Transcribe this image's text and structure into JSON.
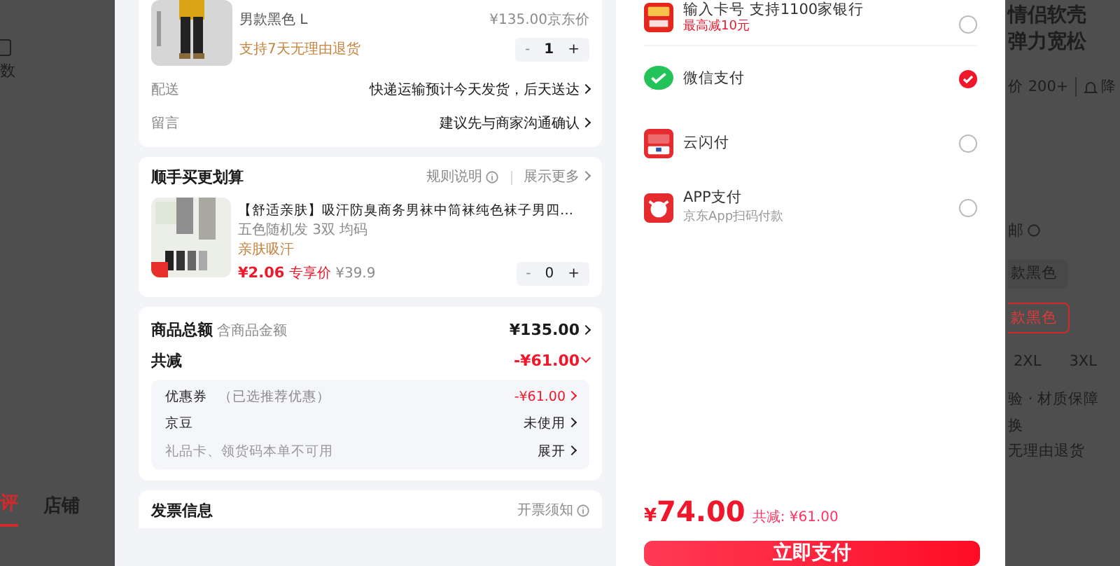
{
  "background_page": {
    "left_texts": [
      "数"
    ],
    "tabs": [
      {
        "label": "评",
        "selected": true
      },
      {
        "label": "店铺",
        "selected": false
      }
    ],
    "right_title": [
      "情侣软壳",
      "弹力宽松"
    ],
    "right_stats": [
      "价 200+",
      "降"
    ],
    "right_section": "邮",
    "colors": [
      {
        "label": "款黑色",
        "selected": false
      },
      {
        "label": "款黑色",
        "selected": true
      }
    ],
    "sizes": [
      "2XL",
      "3XL"
    ],
    "service_title": "验 · 材质保障",
    "services": [
      "换",
      "无理由退货"
    ]
  },
  "product": {
    "variant": "男款黑色  L",
    "service": "支持7天无理由退货",
    "price": "¥135.00",
    "price_label": "京东价",
    "quantity": "1",
    "minus": "-",
    "plus": "+"
  },
  "order_rows": [
    {
      "label": "配送",
      "value": "快递运输预计今天发货，后天送达"
    },
    {
      "label": "留言",
      "value": "建议先与商家沟通确认"
    }
  ],
  "addon": {
    "title": "顺手买更划算",
    "rules": "规则说明",
    "more": "展示更多",
    "item": {
      "title": "【舒适亲肤】吸汗防臭商务男袜中筒袜纯色袜子男四…",
      "spec": "五色随机发 3双 均码",
      "tag": "亲肤吸汗",
      "price": "¥2.06",
      "price_label": "专享价",
      "original_price": "¥39.9",
      "quantity": "0",
      "minus": "-",
      "plus": "+"
    }
  },
  "totals": {
    "total_label": "商品总额",
    "total_hint": "含商品金额",
    "total_value": "¥135.00",
    "discount_label": "共减",
    "discount_value": "-¥61.00",
    "expanded": true,
    "details": [
      {
        "label": "优惠券",
        "hint": "（已选推荐优惠）",
        "value": "-¥61.00",
        "kind": "discount",
        "disabled": false
      },
      {
        "label": "京豆",
        "value": "未使用",
        "kind": "plain",
        "disabled": false
      },
      {
        "label": "礼品卡、领货码本单不可用",
        "value": "展开",
        "kind": "plain",
        "disabled": true
      }
    ]
  },
  "invoice": {
    "title": "发票信息",
    "notice": "开票须知"
  },
  "payment_methods": [
    {
      "name": "输入卡号 支持1100家银行",
      "sub": "最高减10元",
      "selected": false
    },
    {
      "name": "微信支付",
      "selected": true
    },
    {
      "name": "云闪付",
      "selected": false
    },
    {
      "name": "APP支付",
      "sub": "京东App扫码付款",
      "selected": false
    }
  ],
  "footer": {
    "currency": "¥",
    "amount": "74.00",
    "saved": "共减: ¥61.00",
    "pay_button": "立即支付"
  }
}
